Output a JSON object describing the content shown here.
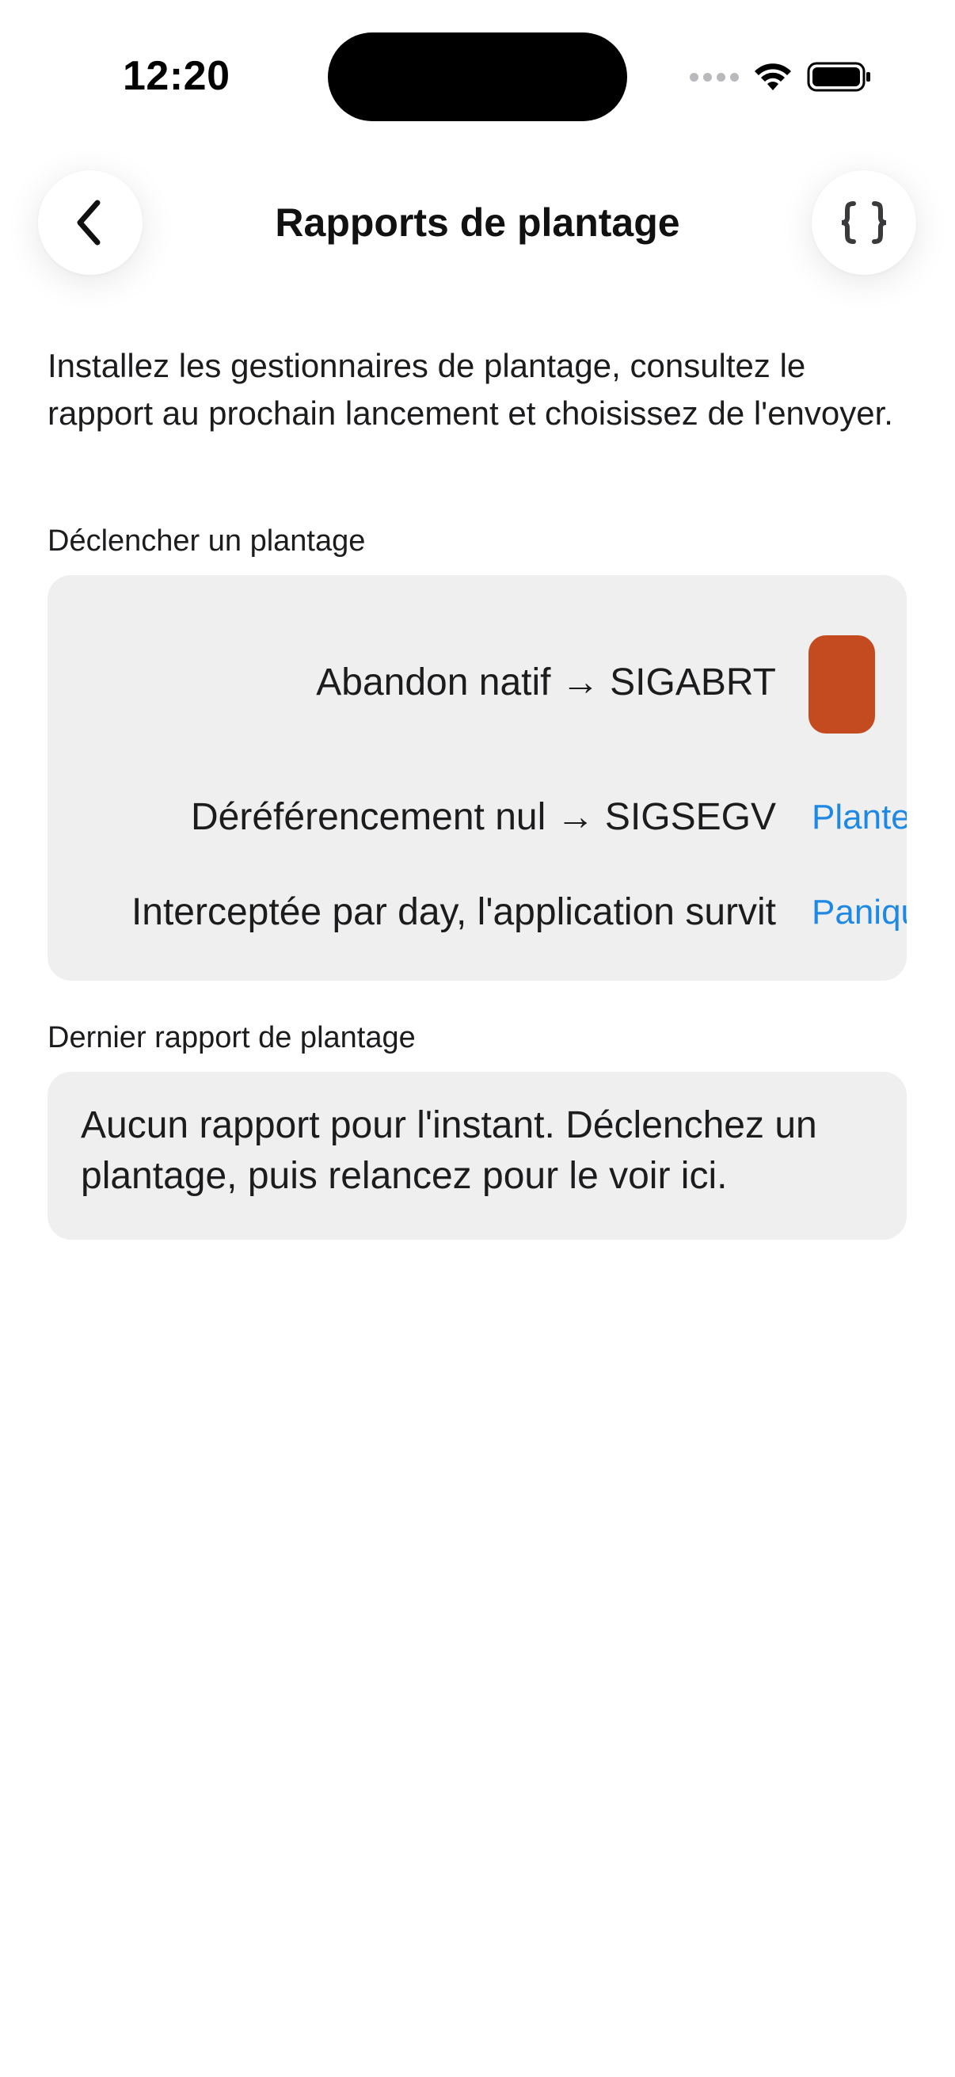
{
  "status_bar": {
    "time": "12:20"
  },
  "nav": {
    "title": "Rapports de plantage",
    "back_icon": "chevron-left-icon",
    "code_icon": "curly-braces-icon"
  },
  "intro": "Installez les gestionnaires de plantage, consultez le rapport au prochain lancement et choisissez de l'envoyer.",
  "trigger_section": {
    "label": "Déclencher un plantage",
    "rows": [
      {
        "label": "Abandon natif → SIGABRT",
        "action": "",
        "action_color": "#c44b20"
      },
      {
        "label": "Déréférencement nul → SIGSEGV",
        "action": "Plante"
      },
      {
        "label": "Interceptée par day, l'application survit",
        "action": "Paniqu"
      }
    ]
  },
  "last_report_section": {
    "label": "Dernier rapport de plantage",
    "text": "Aucun rapport pour l'instant. Déclenchez un plantage, puis relancez pour le voir ici."
  },
  "colors": {
    "accent_blue": "#1e88e5",
    "abort_orange": "#c44b20",
    "card_bg": "#efefef"
  }
}
